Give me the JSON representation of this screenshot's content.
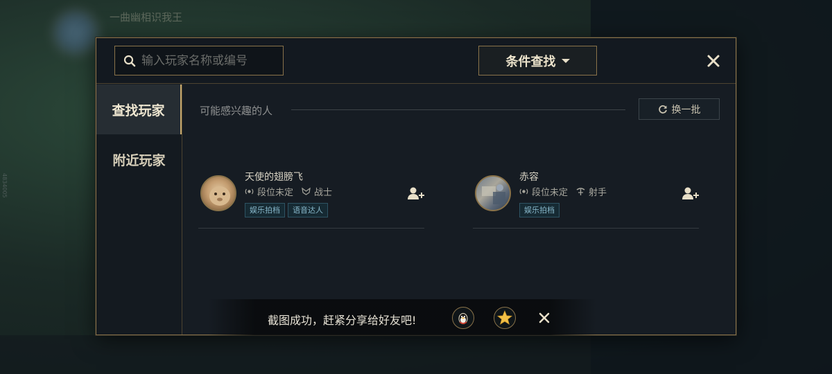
{
  "background": {
    "username": "一曲幽相识我王",
    "side_id": "4834005"
  },
  "search": {
    "placeholder": "输入玩家名称或编号",
    "filter_label": "条件查找"
  },
  "sidebar": {
    "items": [
      {
        "label": "查找玩家",
        "active": true
      },
      {
        "label": "附近玩家",
        "active": false
      }
    ]
  },
  "section": {
    "title": "可能感兴趣的人",
    "refresh_label": "换一批"
  },
  "players": [
    {
      "name": "天使的翅膀飞",
      "rank": "段位未定",
      "role": "战士",
      "tags": [
        "娱乐拍档",
        "语音达人"
      ]
    },
    {
      "name": "赤容",
      "rank": "段位未定",
      "role": "射手",
      "tags": [
        "娱乐拍档"
      ]
    }
  ],
  "toast": {
    "message": "截图成功，赶紧分享给好友吧!"
  },
  "colors": {
    "gold_border": "#8a734a",
    "panel_bg": "#161c23",
    "tag_text": "#86b6c9"
  }
}
